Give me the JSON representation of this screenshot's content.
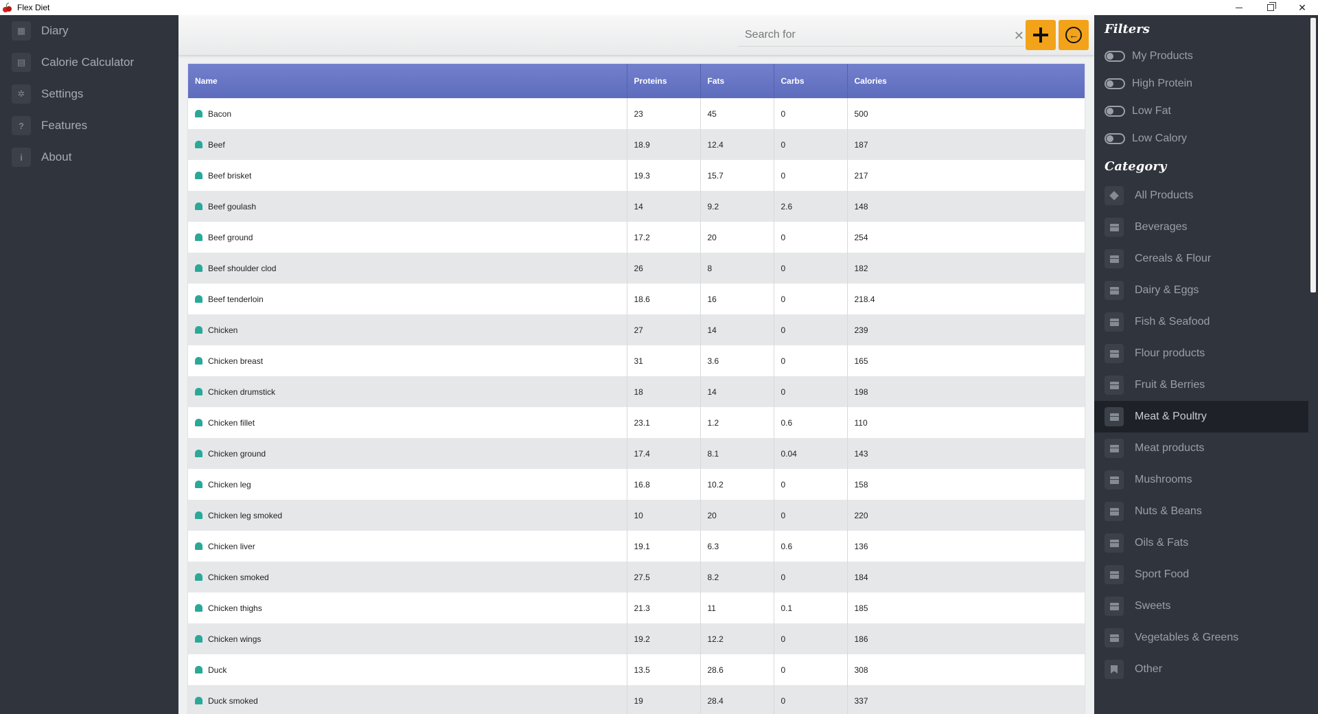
{
  "window": {
    "title": "Flex Diet"
  },
  "sidebar": {
    "items": [
      {
        "label": "Diary",
        "icon": "calendar-icon"
      },
      {
        "label": "Calorie Calculator",
        "icon": "calculator-icon"
      },
      {
        "label": "Settings",
        "icon": "gear-icon"
      },
      {
        "label": "Features",
        "icon": "question-icon"
      },
      {
        "label": "About",
        "icon": "info-icon"
      }
    ]
  },
  "search": {
    "placeholder": "Search for",
    "value": ""
  },
  "table": {
    "headers": [
      "Name",
      "Proteins",
      "Fats",
      "Carbs",
      "Calories"
    ],
    "rows": [
      [
        "Bacon",
        "23",
        "45",
        "0",
        "500"
      ],
      [
        "Beef",
        "18.9",
        "12.4",
        "0",
        "187"
      ],
      [
        "Beef brisket",
        "19.3",
        "15.7",
        "0",
        "217"
      ],
      [
        "Beef goulash",
        "14",
        "9.2",
        "2.6",
        "148"
      ],
      [
        "Beef ground",
        "17.2",
        "20",
        "0",
        "254"
      ],
      [
        "Beef shoulder clod",
        "26",
        "8",
        "0",
        "182"
      ],
      [
        "Beef tenderloin",
        "18.6",
        "16",
        "0",
        "218.4"
      ],
      [
        "Chicken",
        "27",
        "14",
        "0",
        "239"
      ],
      [
        "Chicken breast",
        "31",
        "3.6",
        "0",
        "165"
      ],
      [
        "Chicken drumstick",
        "18",
        "14",
        "0",
        "198"
      ],
      [
        "Chicken fillet",
        "23.1",
        "1.2",
        "0.6",
        "110"
      ],
      [
        "Chicken ground",
        "17.4",
        "8.1",
        "0.04",
        "143"
      ],
      [
        "Chicken leg",
        "16.8",
        "10.2",
        "0",
        "158"
      ],
      [
        "Chicken leg smoked",
        "10",
        "20",
        "0",
        "220"
      ],
      [
        "Chicken liver",
        "19.1",
        "6.3",
        "0.6",
        "136"
      ],
      [
        "Chicken smoked",
        "27.5",
        "8.2",
        "0",
        "184"
      ],
      [
        "Chicken thighs",
        "21.3",
        "11",
        "0.1",
        "185"
      ],
      [
        "Chicken wings",
        "19.2",
        "12.2",
        "0",
        "186"
      ],
      [
        "Duck",
        "13.5",
        "28.6",
        "0",
        "308"
      ],
      [
        "Duck smoked",
        "19",
        "28.4",
        "0",
        "337"
      ]
    ]
  },
  "filters": {
    "heading": "Filters",
    "items": [
      {
        "label": "My Products",
        "on": false
      },
      {
        "label": "High Protein",
        "on": false
      },
      {
        "label": "Low Fat",
        "on": false
      },
      {
        "label": "Low Calory",
        "on": false
      }
    ]
  },
  "category": {
    "heading": "Category",
    "active": "Meat & Poultry",
    "items": [
      {
        "label": "All Products",
        "icon": "layers-icon"
      },
      {
        "label": "Beverages",
        "icon": "box-icon"
      },
      {
        "label": "Cereals & Flour",
        "icon": "box-icon"
      },
      {
        "label": "Dairy & Eggs",
        "icon": "box-icon"
      },
      {
        "label": "Fish & Seafood",
        "icon": "box-icon"
      },
      {
        "label": "Flour products",
        "icon": "box-icon"
      },
      {
        "label": "Fruit & Berries",
        "icon": "box-icon"
      },
      {
        "label": "Meat & Poultry",
        "icon": "box-icon"
      },
      {
        "label": "Meat products",
        "icon": "box-icon"
      },
      {
        "label": "Mushrooms",
        "icon": "box-icon"
      },
      {
        "label": "Nuts & Beans",
        "icon": "box-icon"
      },
      {
        "label": "Oils & Fats",
        "icon": "box-icon"
      },
      {
        "label": "Sport Food",
        "icon": "box-icon"
      },
      {
        "label": "Sweets",
        "icon": "box-icon"
      },
      {
        "label": "Vegetables & Greens",
        "icon": "box-icon"
      },
      {
        "label": "Other",
        "icon": "bookmark-icon"
      }
    ]
  },
  "colors": {
    "accent": "#f2a31a",
    "table_header": "#6674c4",
    "sidebar_bg": "#30343d",
    "row_icon": "#2aa898"
  }
}
